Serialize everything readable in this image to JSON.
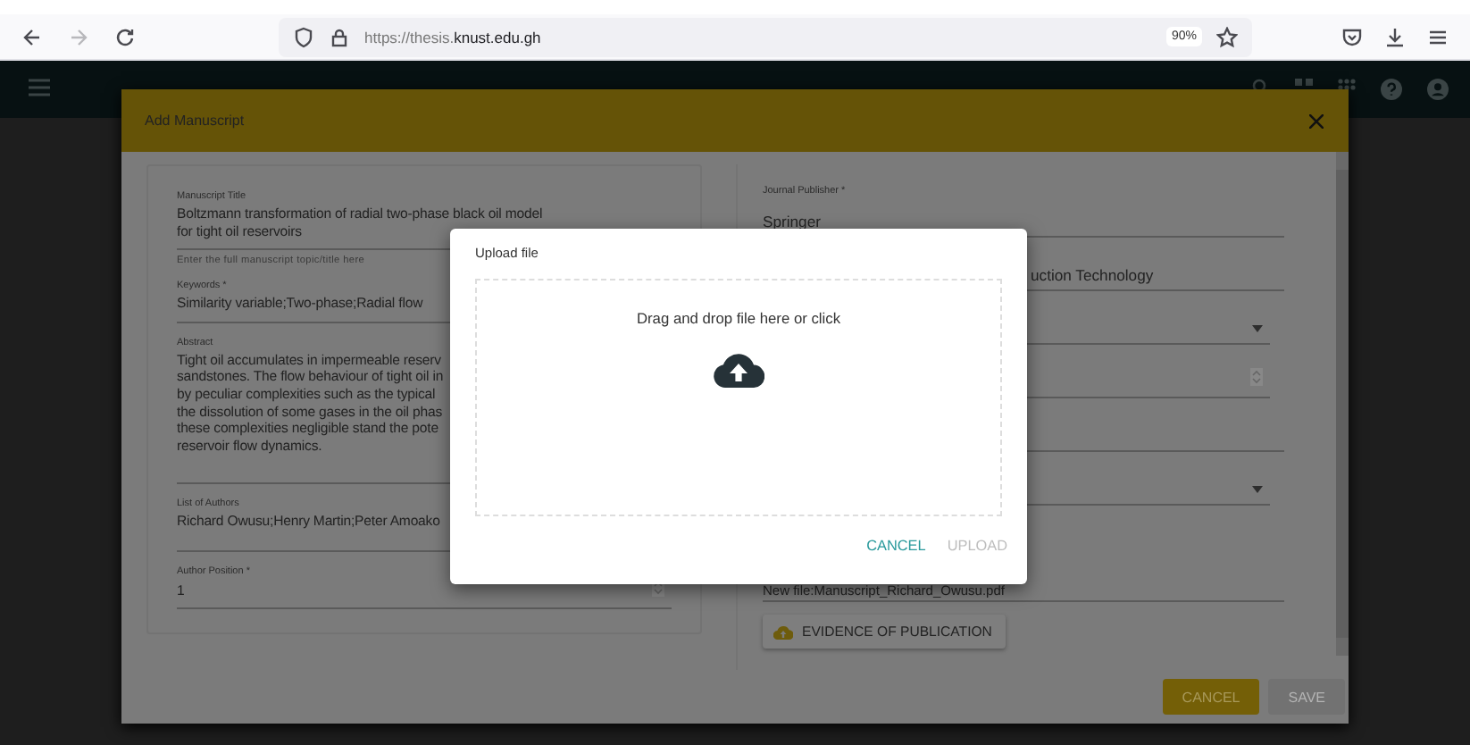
{
  "browser": {
    "back_enabled": true,
    "forward_enabled": false,
    "url": "https://thesis.**knust.edu.gh**",
    "zoom": "90%"
  },
  "dialog": {
    "title": "Add Manuscript",
    "left_fields": [
      {
        "kind": "text",
        "label": "Manuscript Title",
        "lines": [
          "Boltzmann transformation of radial two-phase black oil model",
          "for tight oil reservoirs"
        ],
        "helper": "Enter the full manuscript topic/title here"
      },
      {
        "kind": "text",
        "label": "Keywords *",
        "lines": [
          "Similarity variable;Two-phase;Radial flow"
        ]
      },
      {
        "kind": "textarea",
        "label": "Abstract",
        "lines": [
          "Tight oil accumulates in impermeable reserv",
          "sandstones. The flow behaviour of tight oil in",
          "by peculiar complexities such as the typical",
          "the dissolution of some gases in the oil phas",
          "these complexities negligible stand the pote",
          "reservoir flow dynamics."
        ]
      },
      {
        "kind": "text",
        "label": "List of Authors",
        "lines": [
          "Richard Owusu;Henry Martin;Peter Amoako"
        ]
      },
      {
        "kind": "number",
        "label": "Author Position *",
        "lines": [
          "1"
        ]
      }
    ],
    "right_fields": [
      {
        "kind": "text",
        "label": "Journal Publisher *",
        "lines": [
          "Springer"
        ]
      },
      {
        "kind": "text",
        "lines": [
          "uction Technology"
        ]
      },
      {
        "kind": "select"
      },
      {
        "kind": "number"
      },
      {
        "kind": "text"
      },
      {
        "kind": "select"
      },
      {
        "kind": "file",
        "lines": [
          "New file:Manuscript_Richard_Owusu.pdf"
        ],
        "button": "EVIDENCE OF PUBLICATION"
      }
    ],
    "buttons": [
      {
        "label": "CANCEL",
        "disabled": false
      },
      {
        "label": "SAVE",
        "disabled": true
      }
    ]
  },
  "upload": {
    "title": "Upload file",
    "prompt": "Drag and drop file here or click",
    "buttons": [
      {
        "label": "CANCEL",
        "disabled": false
      },
      {
        "label": "UPLOAD",
        "disabled": true
      }
    ]
  }
}
